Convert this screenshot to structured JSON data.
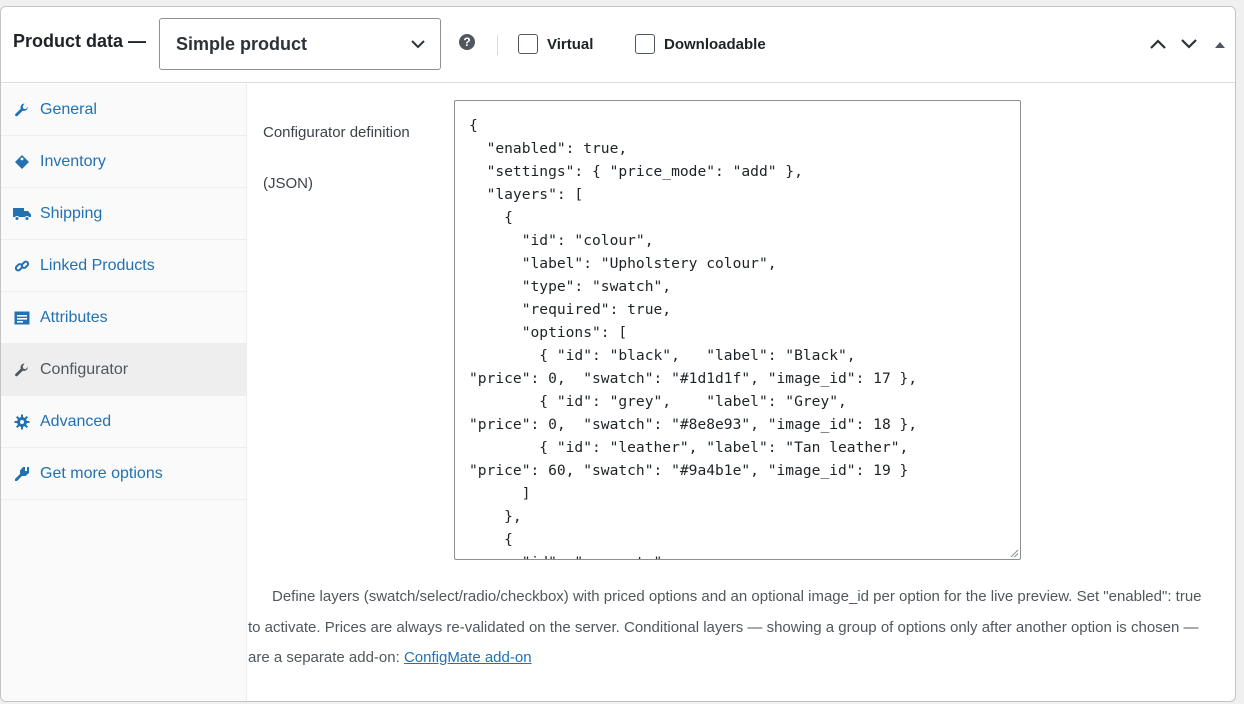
{
  "header": {
    "title": "Product data —",
    "product_type": "Simple product",
    "help_glyph": "?",
    "virtual_label": "Virtual",
    "downloadable_label": "Downloadable"
  },
  "sidebar": {
    "items": [
      {
        "label": "General",
        "icon": "wrench-icon"
      },
      {
        "label": "Inventory",
        "icon": "tag-icon"
      },
      {
        "label": "Shipping",
        "icon": "truck-icon"
      },
      {
        "label": "Linked Products",
        "icon": "link-icon"
      },
      {
        "label": "Attributes",
        "icon": "list-icon"
      },
      {
        "label": "Configurator",
        "icon": "wrench-icon",
        "active": true
      },
      {
        "label": "Advanced",
        "icon": "gear-icon"
      },
      {
        "label": "Get more options",
        "icon": "plugin-icon"
      }
    ]
  },
  "configurator": {
    "label_line1": "Configurator definition",
    "label_line2": "(JSON)",
    "json_text": "{\n  \"enabled\": true,\n  \"settings\": { \"price_mode\": \"add\" },\n  \"layers\": [\n    {\n      \"id\": \"colour\",\n      \"label\": \"Upholstery colour\",\n      \"type\": \"swatch\",\n      \"required\": true,\n      \"options\": [\n        { \"id\": \"black\",   \"label\": \"Black\",\n\"price\": 0,  \"swatch\": \"#1d1d1f\", \"image_id\": 17 },\n        { \"id\": \"grey\",    \"label\": \"Grey\",\n\"price\": 0,  \"swatch\": \"#8e8e93\", \"image_id\": 18 },\n        { \"id\": \"leather\", \"label\": \"Tan leather\",\n\"price\": 60, \"swatch\": \"#9a4b1e\", \"image_id\": 19 }\n      ]\n    },\n    {\n      \"id\": \"armrests\",",
    "description": "Define layers (swatch/select/radio/checkbox) with priced options and an optional image_id per option for the live preview. Set \"enabled\": true to activate. Prices are always re-validated on the server. Conditional layers — showing a group of options only after another option is chosen — are a separate add-on: ",
    "link_text": "ConfigMate add-on"
  },
  "colors": {
    "accent": "#2271b1",
    "text": "#1d2327",
    "muted": "#50575e",
    "border": "#c3c4c7"
  }
}
